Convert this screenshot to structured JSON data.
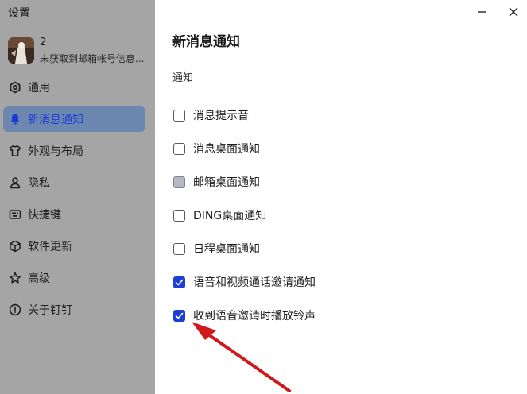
{
  "window": {
    "title": "设置"
  },
  "account": {
    "name": "2",
    "status": "未获取到邮箱帐号信息..."
  },
  "sidebar": {
    "items": [
      {
        "label": "通用",
        "icon": "gear-icon",
        "active": false
      },
      {
        "label": "新消息通知",
        "icon": "bell-icon",
        "active": true
      },
      {
        "label": "外观与布局",
        "icon": "shirt-icon",
        "active": false
      },
      {
        "label": "隐私",
        "icon": "person-icon",
        "active": false
      },
      {
        "label": "快捷键",
        "icon": "keyboard-icon",
        "active": false
      },
      {
        "label": "软件更新",
        "icon": "box-icon",
        "active": false
      },
      {
        "label": "高级",
        "icon": "star-icon",
        "active": false
      },
      {
        "label": "关于钉钉",
        "icon": "info-icon",
        "active": false
      }
    ]
  },
  "main": {
    "title": "新消息通知",
    "section": "通知",
    "options": [
      {
        "label": "消息提示音",
        "state": "unchecked"
      },
      {
        "label": "消息桌面通知",
        "state": "unchecked"
      },
      {
        "label": "邮箱桌面通知",
        "state": "disabled"
      },
      {
        "label": "DING桌面通知",
        "state": "unchecked"
      },
      {
        "label": "日程桌面通知",
        "state": "unchecked"
      },
      {
        "label": "语音和视频通话邀请通知",
        "state": "checked"
      },
      {
        "label": "收到语音邀请时播放铃声",
        "state": "checked"
      }
    ]
  },
  "colors": {
    "accent": "#1c3fd8",
    "sidebar_bg": "#a5a5a5",
    "active_item_bg": "#6d88b0",
    "annotation_arrow": "#d0191a"
  }
}
